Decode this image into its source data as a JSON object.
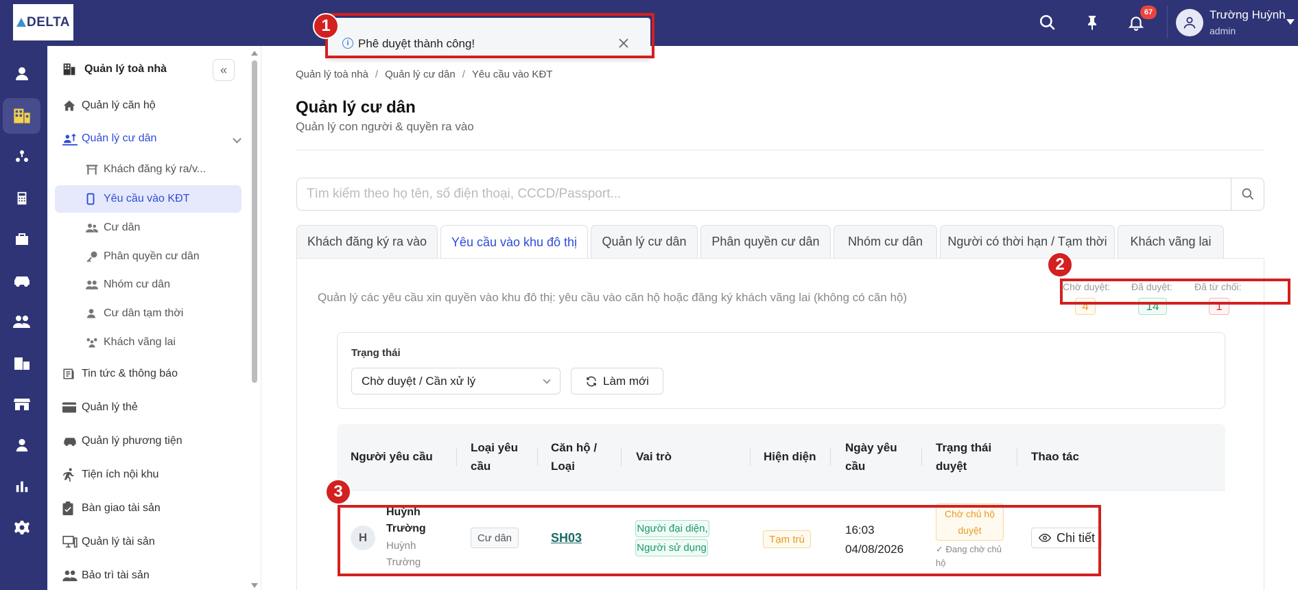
{
  "app": {
    "logo_text": "DELTA"
  },
  "topbar": {
    "notification_count": "67",
    "user_name": "Trường Huỳnh",
    "user_role": "admin"
  },
  "sidebar": {
    "header": "Quản lý toà nhà",
    "items": {
      "apartment": "Quản lý căn hộ",
      "resident": "Quản lý cư dân",
      "news": "Tin tức & thông báo",
      "card": "Quản lý thẻ",
      "vehicle": "Quản lý phương tiện",
      "amenity": "Tiện ích nội khu",
      "handover": "Bàn giao tài sản",
      "asset": "Quản lý tài sản",
      "maintenance": "Bảo trì tài sản"
    },
    "sub_items": {
      "guest_register": "Khách đăng ký ra/v...",
      "entry_request": "Yêu cầu vào KĐT",
      "resident_list": "Cư dân",
      "resident_perm": "Phân quyền cư dân",
      "resident_group": "Nhóm cư dân",
      "temp_resident": "Cư dân tạm thời",
      "visitor": "Khách vãng lai"
    }
  },
  "breadcrumb": {
    "c1": "Quản lý toà nhà",
    "c2": "Quản lý cư dân",
    "c3": "Yêu cầu vào KĐT"
  },
  "page": {
    "title": "Quản lý cư dân",
    "subtitle": "Quản lý con người & quyền ra vào"
  },
  "search": {
    "placeholder": "Tìm kiếm theo họ tên, số điện thoại, CCCD/Passport..."
  },
  "tabs": {
    "t1": "Khách đăng ký ra vào",
    "t2": "Yêu cầu vào khu đô thị",
    "t3": "Quản lý cư dân",
    "t4": "Phân quyền cư dân",
    "t5": "Nhóm cư dân",
    "t6": "Người có thời hạn / Tạm thời",
    "t7": "Khách vãng lai"
  },
  "panel": {
    "description": "Quản lý các yêu cầu xin quyền vào khu đô thị: yêu cầu vào căn hộ hoặc đăng ký khách vãng lai (không có căn hộ)",
    "stats": {
      "pending_label": "Chờ duyệt:",
      "pending_value": "4",
      "approved_label": "Đã duyệt:",
      "approved_value": "14",
      "rejected_label": "Đã từ chối:",
      "rejected_value": "1"
    }
  },
  "filter": {
    "status_label": "Trạng thái",
    "status_value": "Chờ duyệt / Cần xử lý",
    "refresh_label": "Làm mới"
  },
  "table": {
    "headers": {
      "requester": "Người yêu cầu",
      "type_l1": "Loại yêu",
      "type_l2": "cầu",
      "apt_l1": "Căn hộ /",
      "apt_l2": "Loại",
      "role": "Vai trò",
      "presence": "Hiện diện",
      "date_l1": "Ngày yêu",
      "date_l2": "cầu",
      "status_l1": "Trạng thái",
      "status_l2": "duyệt",
      "action": "Thao tác"
    },
    "row": {
      "avatar_initial": "H",
      "name_l1": "Huỳnh",
      "name_l2": "Trường",
      "sub_l1": "Huỳnh",
      "sub_l2": "Trường",
      "type": "Cư dân",
      "apartment": "SH03",
      "role_1": "Người đại diện,",
      "role_2": "Người sử dụng",
      "presence": "Tạm trú",
      "time": "16:03",
      "date": "04/08/2026",
      "status_l1": "Chờ chủ hộ",
      "status_l2": "duyệt",
      "status_note_l1": "✓ Đang chờ chủ",
      "status_note_l2": "hộ",
      "action": "Chi tiết"
    }
  },
  "toast": {
    "message": "Phê duyệt thành công!"
  },
  "annotations": {
    "n1": "1",
    "n2": "2",
    "n3": "3"
  },
  "colors": {
    "primary": "#2e3475",
    "accent": "#2f4cd6",
    "highlight": "#d32020",
    "pending": "#e69a1f",
    "approved": "#1a9a6a",
    "rejected": "#d9363e"
  }
}
